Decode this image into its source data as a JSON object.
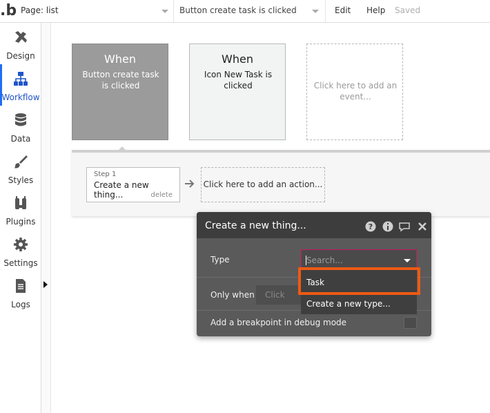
{
  "topbar": {
    "logo": ".b",
    "page_select": "Page: list",
    "event_select": "Button create task is clicked",
    "edit": "Edit",
    "help": "Help",
    "saved": "Saved"
  },
  "sidebar": {
    "items": [
      {
        "label": "Design",
        "icon": "design-icon"
      },
      {
        "label": "Workflow",
        "icon": "workflow-icon",
        "active": true
      },
      {
        "label": "Data",
        "icon": "database-icon"
      },
      {
        "label": "Styles",
        "icon": "brush-icon"
      },
      {
        "label": "Plugins",
        "icon": "plug-icon"
      },
      {
        "label": "Settings",
        "icon": "gear-icon"
      },
      {
        "label": "Logs",
        "icon": "document-icon"
      }
    ]
  },
  "events": [
    {
      "when": "When",
      "desc": "Button create task is clicked",
      "active": true
    },
    {
      "when": "When",
      "desc": "Icon New Task is clicked"
    },
    {
      "desc": "Click here to add an event..."
    }
  ],
  "actions": {
    "step_number": "Step 1",
    "step_name": "Create a new thing...",
    "delete": "delete",
    "add_action": "Click here to add an action..."
  },
  "popup": {
    "title": "Create a new thing...",
    "type_label": "Type",
    "type_placeholder": "Search...",
    "only_when_label": "Only when",
    "only_when_placeholder": "Click",
    "breakpoint_label": "Add a breakpoint in debug mode",
    "dropdown_options": [
      "Task",
      "Create a new type..."
    ],
    "highlight_color": "#ee5a15"
  }
}
